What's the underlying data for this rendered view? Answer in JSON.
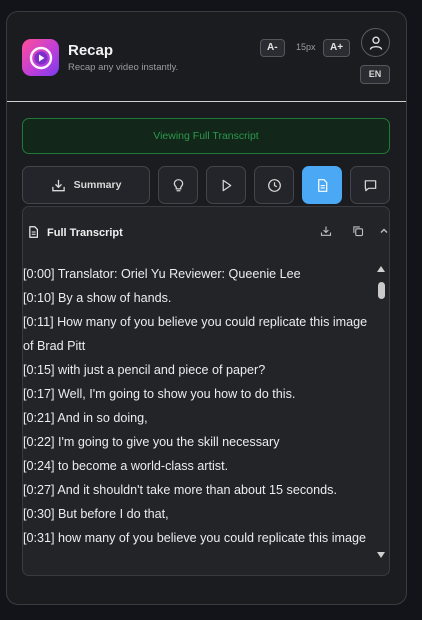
{
  "app": {
    "title": "Recap",
    "subtitle": "Recap any video instantly."
  },
  "font_controls": {
    "decrease": "A-",
    "size": "15px",
    "increase": "A+"
  },
  "language": "EN",
  "banner": "Viewing Full Transcript",
  "toolbar": {
    "summary_label": "Summary",
    "buttons": [
      "lightbulb-icon",
      "play-icon",
      "clock-icon",
      "document-icon",
      "chat-icon"
    ],
    "active": "document-icon"
  },
  "transcript": {
    "title": "Full Transcript",
    "lines": [
      "[0:00] Translator: Oriel Yu Reviewer: Queenie Lee",
      "[0:10] By a show of hands.",
      "[0:11] How many of you believe you could replicate this image of Brad Pitt",
      "[0:15] with just a pencil and piece of paper?",
      "[0:17] Well, I'm going to show you how to do this.",
      "[0:21] And in so doing,",
      "[0:22] I'm going to give you the skill necessary",
      "[0:24] to become a world-class artist.",
      "[0:27] And it shouldn't take more than about 15 seconds.",
      "[0:30] But before I do that,",
      "[0:31] how many of you believe you could replicate this image"
    ]
  },
  "colors": {
    "accent": "#4aa8f5",
    "banner_border": "#1f7a3a",
    "banner_text": "#2a9a4b"
  }
}
